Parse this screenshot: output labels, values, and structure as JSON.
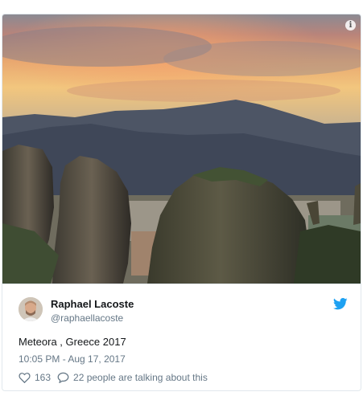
{
  "media": {
    "info_icon": "info-icon",
    "scene": "mountain-sunset-photo"
  },
  "tweet": {
    "author_name": "Raphael Lacoste",
    "author_handle": "@raphaellacoste",
    "text": "Meteora , Greece 2017",
    "timestamp": "10:05 PM - Aug 17, 2017",
    "likes": "163",
    "talking": "22 people are talking about this",
    "icons": {
      "brand": "twitter-bird-icon",
      "like": "heart-icon",
      "reply": "speech-bubble-icon"
    }
  },
  "colors": {
    "brand": "#1da1f2",
    "text": "#14171a",
    "secondary": "#657786",
    "border": "#e1e8ed"
  }
}
